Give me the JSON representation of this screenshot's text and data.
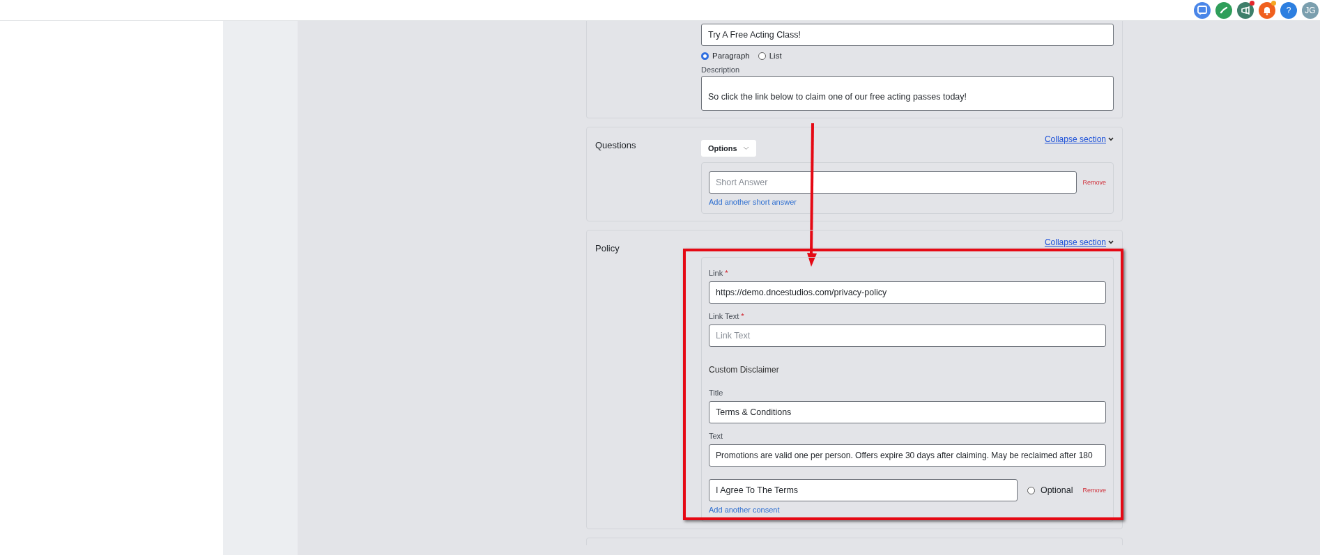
{
  "header": {
    "icons": [
      {
        "kind": "chat",
        "color": "#4a86e8",
        "badge": false
      },
      {
        "kind": "phone",
        "color": "#2f9e5a",
        "badge": false
      },
      {
        "kind": "megaphone",
        "color": "#3e7f6a",
        "badge": true
      },
      {
        "kind": "bell",
        "color": "#f0601e",
        "badge": true
      },
      {
        "kind": "help",
        "color": "#2d7fe0",
        "badge": false,
        "label": "?"
      },
      {
        "kind": "avatar",
        "color": "#7b9fae",
        "badge": false,
        "label": "JG"
      }
    ]
  },
  "content_section": {
    "title_value": "Try A Free Acting Class!",
    "formats": [
      {
        "label": "Paragraph",
        "selected": true
      },
      {
        "label": "List",
        "selected": false
      }
    ],
    "description_label": "Description",
    "description_value": "So click the link below to claim one of our free acting passes today!"
  },
  "questions": {
    "title": "Questions",
    "collapse": "Collapse section",
    "options": "Options",
    "answers": [
      {
        "placeholder": "Short Answer",
        "remove": "Remove"
      }
    ],
    "add_link": "Add another short answer"
  },
  "policy": {
    "title": "Policy",
    "collapse": "Collapse section",
    "link": {
      "label": "Link",
      "required_mark": "*",
      "value": "https://demo.dncestudios.com/privacy-policy"
    },
    "link_text": {
      "label": "Link Text",
      "required_mark": "*",
      "placeholder": "Link Text"
    },
    "disclaimer_heading": "Custom Disclaimer",
    "disclaimer_title": {
      "label": "Title",
      "value": "Terms & Conditions"
    },
    "disclaimer_text": {
      "label": "Text",
      "value": "Promotions are valid one per person. Offers expire 30 days after claiming. May be reclaimed after 180"
    },
    "consents": [
      {
        "value": "I Agree To The Terms",
        "optional": false,
        "optional_label": "Optional",
        "remove": "Remove"
      }
    ],
    "add_link": "Add another consent"
  }
}
